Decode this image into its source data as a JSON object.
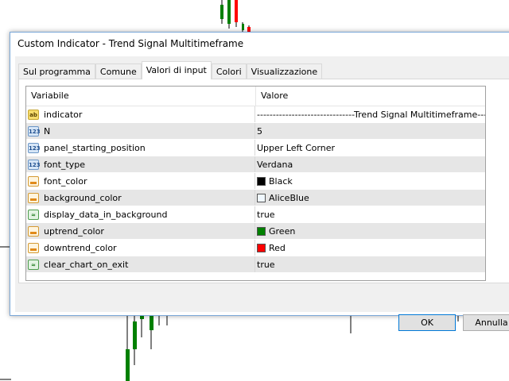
{
  "dialog": {
    "title": "Custom Indicator - Trend Signal Multitimeframe",
    "tabs": [
      {
        "label": "Sul programma"
      },
      {
        "label": "Comune"
      },
      {
        "label": "Valori di input"
      },
      {
        "label": "Colori"
      },
      {
        "label": "Visualizzazione"
      }
    ],
    "active_tab": "Valori di input",
    "grid": {
      "col_variable": "Variabile",
      "col_value": "Valore",
      "rows": [
        {
          "name": "indicator",
          "value": "-------------------------------Trend Signal Multitimeframe-----------------------",
          "icon": "string-icon",
          "type_glyph": "ab"
        },
        {
          "name": "N",
          "value": "5",
          "icon": "integer-icon",
          "type_glyph": "123"
        },
        {
          "name": "panel_starting_position",
          "value": "Upper Left Corner",
          "icon": "integer-icon",
          "type_glyph": "123"
        },
        {
          "name": "font_type",
          "value": "Verdana",
          "icon": "integer-icon",
          "type_glyph": "123"
        },
        {
          "name": "font_color",
          "value": "Black",
          "icon": "color-icon",
          "swatch": "#000000"
        },
        {
          "name": "background_color",
          "value": "AliceBlue",
          "icon": "color-icon",
          "swatch": "#f0f8ff"
        },
        {
          "name": "display_data_in_background",
          "value": "true",
          "icon": "boolean-icon",
          "type_glyph": "≈"
        },
        {
          "name": "uptrend_color",
          "value": "Green",
          "icon": "color-icon",
          "swatch": "#008000"
        },
        {
          "name": "downtrend_color",
          "value": "Red",
          "icon": "color-icon",
          "swatch": "#ff0000"
        },
        {
          "name": "clear_chart_on_exit",
          "value": "true",
          "icon": "boolean-icon",
          "type_glyph": "≈"
        }
      ]
    },
    "buttons": {
      "ok": "OK",
      "cancel": "Annulla"
    }
  },
  "colors": {
    "accent": "#0078d7",
    "row_alt": "#e6e6e6",
    "candle_green": "#008000",
    "candle_red": "#ff0000"
  }
}
